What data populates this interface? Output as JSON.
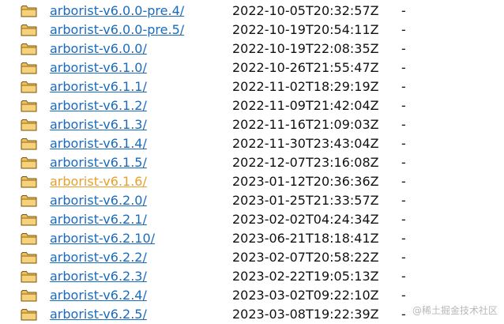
{
  "rows": [
    {
      "name": "arborist-v6.0.0-pre.4/",
      "date": "2022-10-05T20:32:57Z",
      "size": "-"
    },
    {
      "name": "arborist-v6.0.0-pre.5/",
      "date": "2022-10-19T20:54:11Z",
      "size": "-"
    },
    {
      "name": "arborist-v6.0.0/",
      "date": "2022-10-19T22:08:35Z",
      "size": "-"
    },
    {
      "name": "arborist-v6.1.0/",
      "date": "2022-10-26T21:55:47Z",
      "size": "-"
    },
    {
      "name": "arborist-v6.1.1/",
      "date": "2022-11-02T18:29:19Z",
      "size": "-"
    },
    {
      "name": "arborist-v6.1.2/",
      "date": "2022-11-09T21:42:04Z",
      "size": "-"
    },
    {
      "name": "arborist-v6.1.3/",
      "date": "2022-11-16T21:09:03Z",
      "size": "-"
    },
    {
      "name": "arborist-v6.1.4/",
      "date": "2022-11-30T23:43:04Z",
      "size": "-"
    },
    {
      "name": "arborist-v6.1.5/",
      "date": "2022-12-07T23:16:08Z",
      "size": "-"
    },
    {
      "name": "arborist-v6.1.6/",
      "date": "2023-01-12T20:36:36Z",
      "size": "-",
      "visited": true
    },
    {
      "name": "arborist-v6.2.0/",
      "date": "2023-01-25T21:33:57Z",
      "size": "-"
    },
    {
      "name": "arborist-v6.2.1/",
      "date": "2023-02-02T04:24:34Z",
      "size": "-"
    },
    {
      "name": "arborist-v6.2.10/",
      "date": "2023-06-21T18:18:41Z",
      "size": "-"
    },
    {
      "name": "arborist-v6.2.2/",
      "date": "2023-02-07T20:58:22Z",
      "size": "-"
    },
    {
      "name": "arborist-v6.2.3/",
      "date": "2023-02-22T19:05:13Z",
      "size": "-"
    },
    {
      "name": "arborist-v6.2.4/",
      "date": "2023-03-02T09:22:10Z",
      "size": "-"
    },
    {
      "name": "arborist-v6.2.5/",
      "date": "2023-03-08T19:22:39Z",
      "size": "-"
    }
  ],
  "icon": "folder-icon",
  "colors": {
    "link": "#1a6bbf",
    "visited_link": "#e8a02a",
    "folder_fill": "#f0c05a",
    "folder_stroke": "#7a5a10"
  },
  "watermark": "@稀土掘金技术社区"
}
